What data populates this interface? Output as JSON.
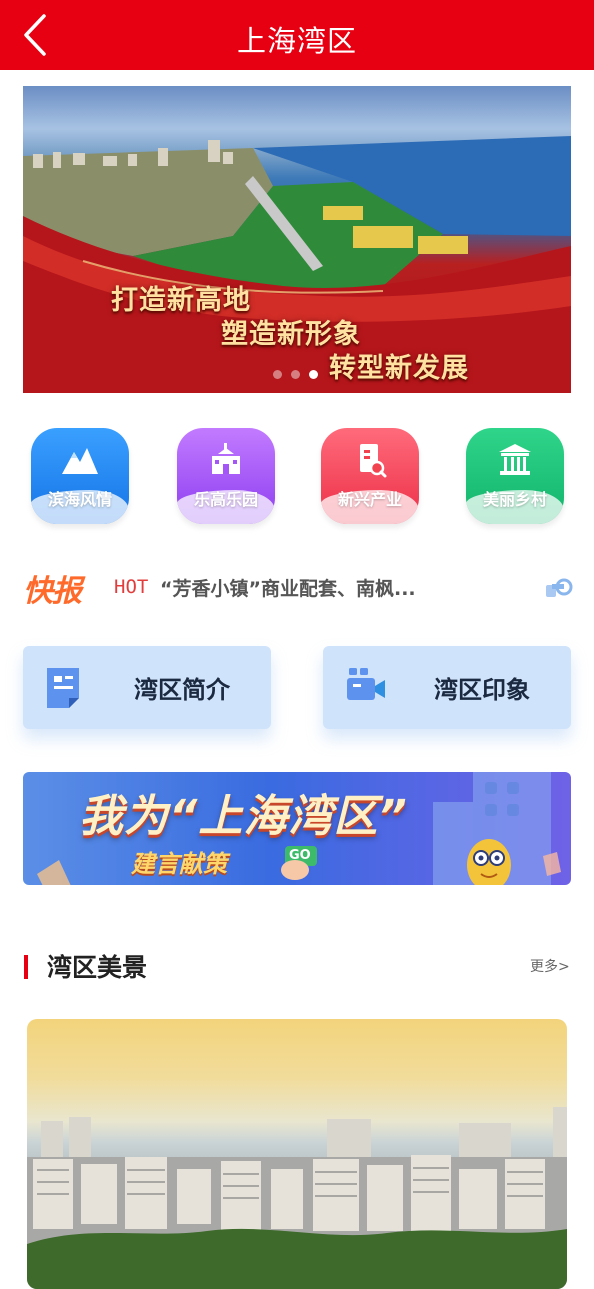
{
  "header": {
    "title": "上海湾区"
  },
  "banner": {
    "slogans": [
      "打造新高地",
      "塑造新形象",
      "转型新发展"
    ],
    "slide_count": 3,
    "active_slide": 3
  },
  "categories": [
    {
      "label": "滨海风情",
      "icon": "mountain-icon",
      "color": "#1f86f2"
    },
    {
      "label": "乐高乐园",
      "icon": "castle-icon",
      "color": "#a556f6"
    },
    {
      "label": "新兴产业",
      "icon": "document-search-icon",
      "color": "#f2414f"
    },
    {
      "label": "美丽乡村",
      "icon": "pavilion-icon",
      "color": "#1ec47a"
    }
  ],
  "news": {
    "tag": "快报",
    "hot_label": "HOT",
    "headline": "“芳香小镇”商业配套、南枫..."
  },
  "buttons": [
    {
      "label": "湾区简介",
      "icon": "document-icon"
    },
    {
      "label": "湾区印象",
      "icon": "video-camera-icon"
    }
  ],
  "promo": {
    "title": "我为“上海湾区”",
    "subtitle": "建言献策",
    "go_label": "GO"
  },
  "section": {
    "title": "湾区美景",
    "more_label": "更多>"
  },
  "colors": {
    "primary": "#e60012",
    "accent_orange": "#ff6a2a",
    "button_bg": "#cfe3fb"
  }
}
